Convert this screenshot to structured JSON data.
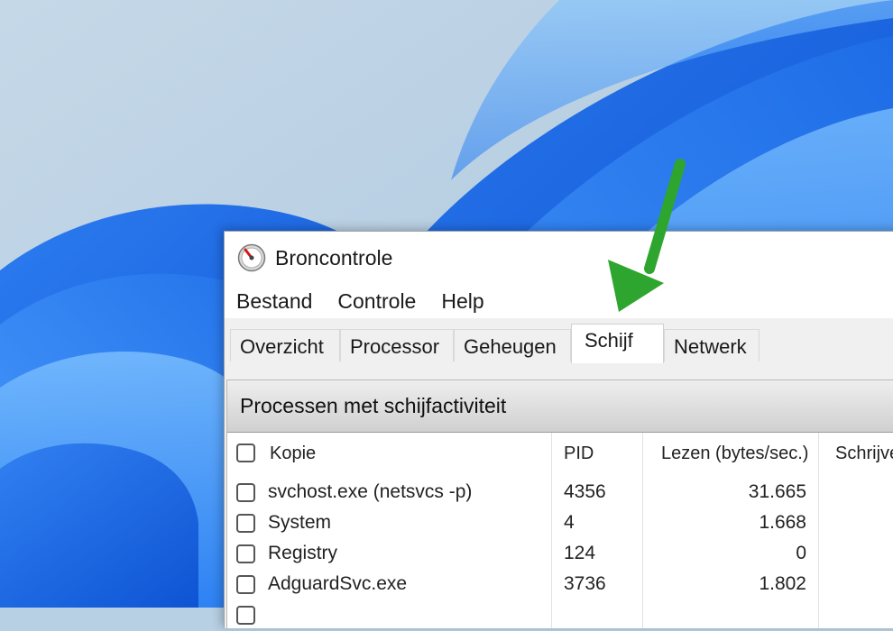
{
  "window": {
    "title": "Broncontrole",
    "icon": "resource-monitor-icon"
  },
  "menu": [
    "Bestand",
    "Controle",
    "Help"
  ],
  "tabs": [
    "Overzicht",
    "Processor",
    "Geheugen",
    "Schijf",
    "Netwerk"
  ],
  "active_tab": "Schijf",
  "section": {
    "title": "Processen met schijfactiviteit"
  },
  "table": {
    "headers": [
      "Kopie",
      "PID",
      "Lezen (bytes/sec.)",
      "Schrijve"
    ],
    "rows": [
      [
        "svchost.exe (netsvcs -p)",
        "4356",
        "31.665"
      ],
      [
        "System",
        "4",
        "1.668"
      ],
      [
        "Registry",
        "124",
        "0"
      ],
      [
        "AdguardSvc.exe",
        "3736",
        "1.802"
      ]
    ]
  },
  "annotation": {
    "arrow_color": "#2ea52e",
    "points_to": "Schijf"
  }
}
